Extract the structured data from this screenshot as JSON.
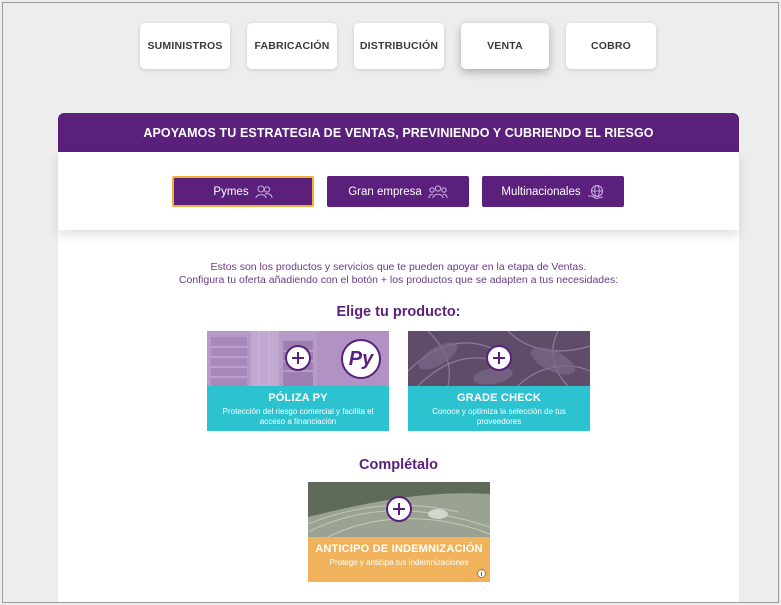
{
  "stages": [
    {
      "label": "SUMINISTROS",
      "active": false
    },
    {
      "label": "FABRICACIÓN",
      "active": false
    },
    {
      "label": "DISTRIBUCIÓN",
      "active": false
    },
    {
      "label": "VENTA",
      "active": true
    },
    {
      "label": "COBRO",
      "active": false
    }
  ],
  "panel": {
    "title": "APOYAMOS TU ESTRATEGIA DE VENTAS, PREVINIENDO Y CUBRIENDO EL RIESGO",
    "segments": [
      {
        "label": "Pymes",
        "icon": "users-icon",
        "active": true
      },
      {
        "label": "Gran empresa",
        "icon": "group-icon",
        "active": false
      },
      {
        "label": "Multinacionales",
        "icon": "globe-hand-icon",
        "active": false
      }
    ],
    "intro_line1": "Estos son los productos y servicios que te pueden apoyar en la etapa de Ventas.",
    "intro_line2": "Configura tu oferta añadiendo con el botón + los productos que se adapten a tus necesidades:",
    "choose_title": "Elige tu producto:",
    "complete_title": "Complétalo",
    "products": [
      {
        "name": "PÓLIZA PY",
        "description": "Protección del riesgo comercial y facilita el acceso a financiación",
        "logo_text": "Py",
        "color": "#2dc2d0"
      },
      {
        "name": "GRADE CHECK",
        "description": "Conoce y optimiza la selección de tus proveedores",
        "color": "#2dc2d0"
      }
    ],
    "complement": {
      "name": "ANTICIPO DE INDEMNIZACIÓN",
      "description": "Protege y anticipa tus indemnizaciones",
      "info_icon": "i",
      "color": "#f0b35b"
    }
  },
  "colors": {
    "brand": "#5b1f7c",
    "teal": "#2dc2d0",
    "amber": "#f0b35b",
    "highlight": "#f0b03c"
  }
}
